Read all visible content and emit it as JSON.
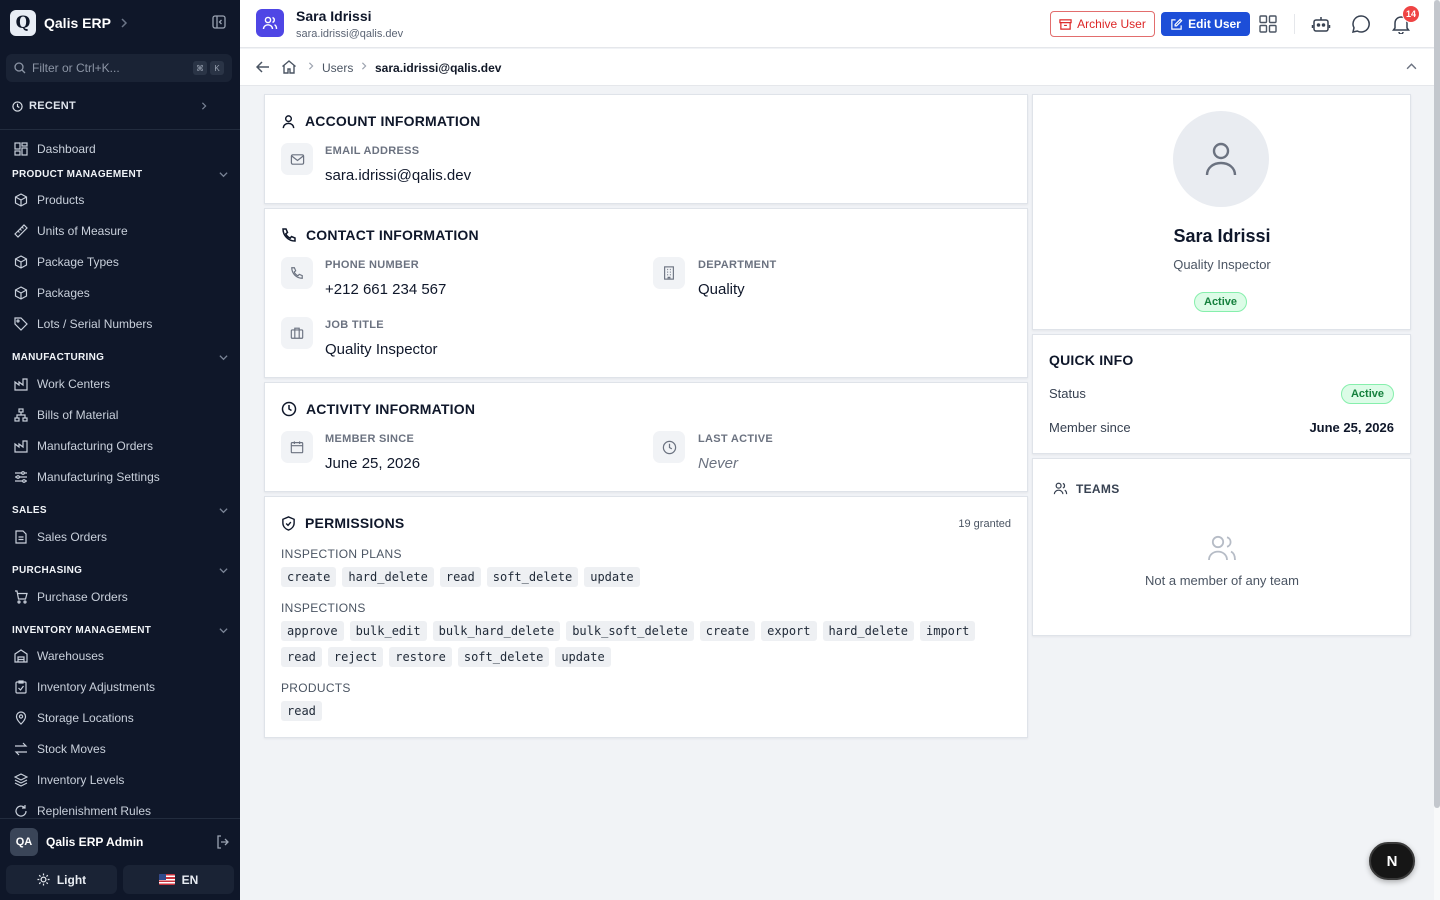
{
  "app": {
    "name": "Qalis ERP",
    "logo_letter": "Q"
  },
  "sidebar": {
    "filter_placeholder": "Filter or Ctrl+K...",
    "kbd": [
      "⌘",
      "K"
    ],
    "recent_label": "RECENT",
    "dashboard": "Dashboard",
    "sections": [
      {
        "title": "PRODUCT MANAGEMENT",
        "items": [
          "Products",
          "Units of Measure",
          "Package Types",
          "Packages",
          "Lots / Serial Numbers"
        ]
      },
      {
        "title": "MANUFACTURING",
        "items": [
          "Work Centers",
          "Bills of Material",
          "Manufacturing Orders",
          "Manufacturing Settings"
        ]
      },
      {
        "title": "SALES",
        "items": [
          "Sales Orders"
        ]
      },
      {
        "title": "PURCHASING",
        "items": [
          "Purchase Orders"
        ]
      },
      {
        "title": "INVENTORY MANAGEMENT",
        "items": [
          "Warehouses",
          "Inventory Adjustments",
          "Storage Locations",
          "Stock Moves",
          "Inventory Levels",
          "Replenishment Rules"
        ]
      }
    ],
    "user": {
      "initials": "QA",
      "name": "Qalis ERP Admin"
    },
    "theme_label": "Light",
    "lang_label": "EN"
  },
  "header": {
    "title": "Sara Idrissi",
    "subtitle": "sara.idrissi@qalis.dev",
    "archive_label": "Archive User",
    "edit_label": "Edit User",
    "notification_count": "14"
  },
  "breadcrumb": {
    "parent": "Users",
    "current": "sara.idrissi@qalis.dev"
  },
  "account": {
    "title": "ACCOUNT INFORMATION",
    "email_label": "EMAIL ADDRESS",
    "email": "sara.idrissi@qalis.dev"
  },
  "contact": {
    "title": "CONTACT INFORMATION",
    "phone_label": "PHONE NUMBER",
    "phone": "+212 661 234 567",
    "department_label": "DEPARTMENT",
    "department": "Quality",
    "job_label": "JOB TITLE",
    "job": "Quality Inspector"
  },
  "activity": {
    "title": "ACTIVITY INFORMATION",
    "member_label": "MEMBER SINCE",
    "member_since": "June 25, 2026",
    "last_label": "LAST ACTIVE",
    "last_active": "Never"
  },
  "permissions": {
    "title": "PERMISSIONS",
    "count": "19 granted",
    "groups": [
      {
        "name": "INSPECTION PLANS",
        "perms": [
          "create",
          "hard_delete",
          "read",
          "soft_delete",
          "update"
        ]
      },
      {
        "name": "INSPECTIONS",
        "perms": [
          "approve",
          "bulk_edit",
          "bulk_hard_delete",
          "bulk_soft_delete",
          "create",
          "export",
          "hard_delete",
          "import",
          "read",
          "reject",
          "restore",
          "soft_delete",
          "update"
        ]
      },
      {
        "name": "PRODUCTS",
        "perms": [
          "read"
        ]
      }
    ]
  },
  "profile": {
    "name": "Sara Idrissi",
    "role": "Quality Inspector",
    "status": "Active"
  },
  "quick_info": {
    "title": "QUICK INFO",
    "status_label": "Status",
    "status": "Active",
    "member_label": "Member since",
    "member_since": "June 25, 2026"
  },
  "teams": {
    "title": "TEAMS",
    "empty_text": "Not a member of any team"
  },
  "next_badge": "N",
  "colors": {
    "sidebar_bg": "#0f1729",
    "primary": "#1d4ed8",
    "danger": "#dc2626",
    "success": "#15803d",
    "header_icon": "#4f46e5"
  }
}
